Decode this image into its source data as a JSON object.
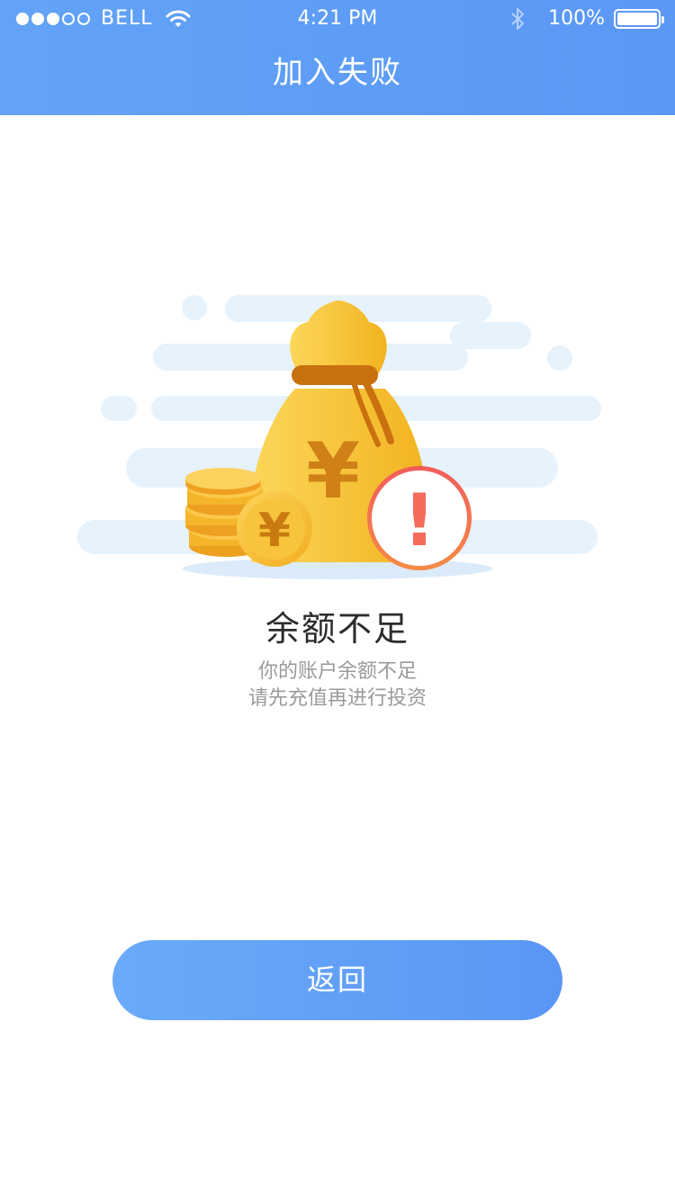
{
  "status_bar": {
    "carrier": "BELL",
    "time": "4:21 PM",
    "battery_percent": "100%",
    "signal_bars_filled": 3,
    "signal_bars_total": 5,
    "icons": [
      "wifi-icon",
      "bluetooth-icon",
      "battery-icon"
    ]
  },
  "nav": {
    "title": "加入失败"
  },
  "illustration": {
    "currency_symbol": "¥",
    "alert_symbol": "!",
    "icons": [
      "money-bag-icon",
      "coin-stack-icon",
      "coin-icon",
      "alert-circle-icon"
    ]
  },
  "content": {
    "headline": "余额不足",
    "message_line1": "你的账户余额不足",
    "message_line2": "请先充值再进行投资"
  },
  "actions": {
    "back_label": "返回"
  },
  "colors": {
    "header": "#5b9cf6",
    "button": "#60a0f7",
    "coin": "#f5b928",
    "alert": "#f46b5c",
    "cloud": "#e8f3fc"
  }
}
